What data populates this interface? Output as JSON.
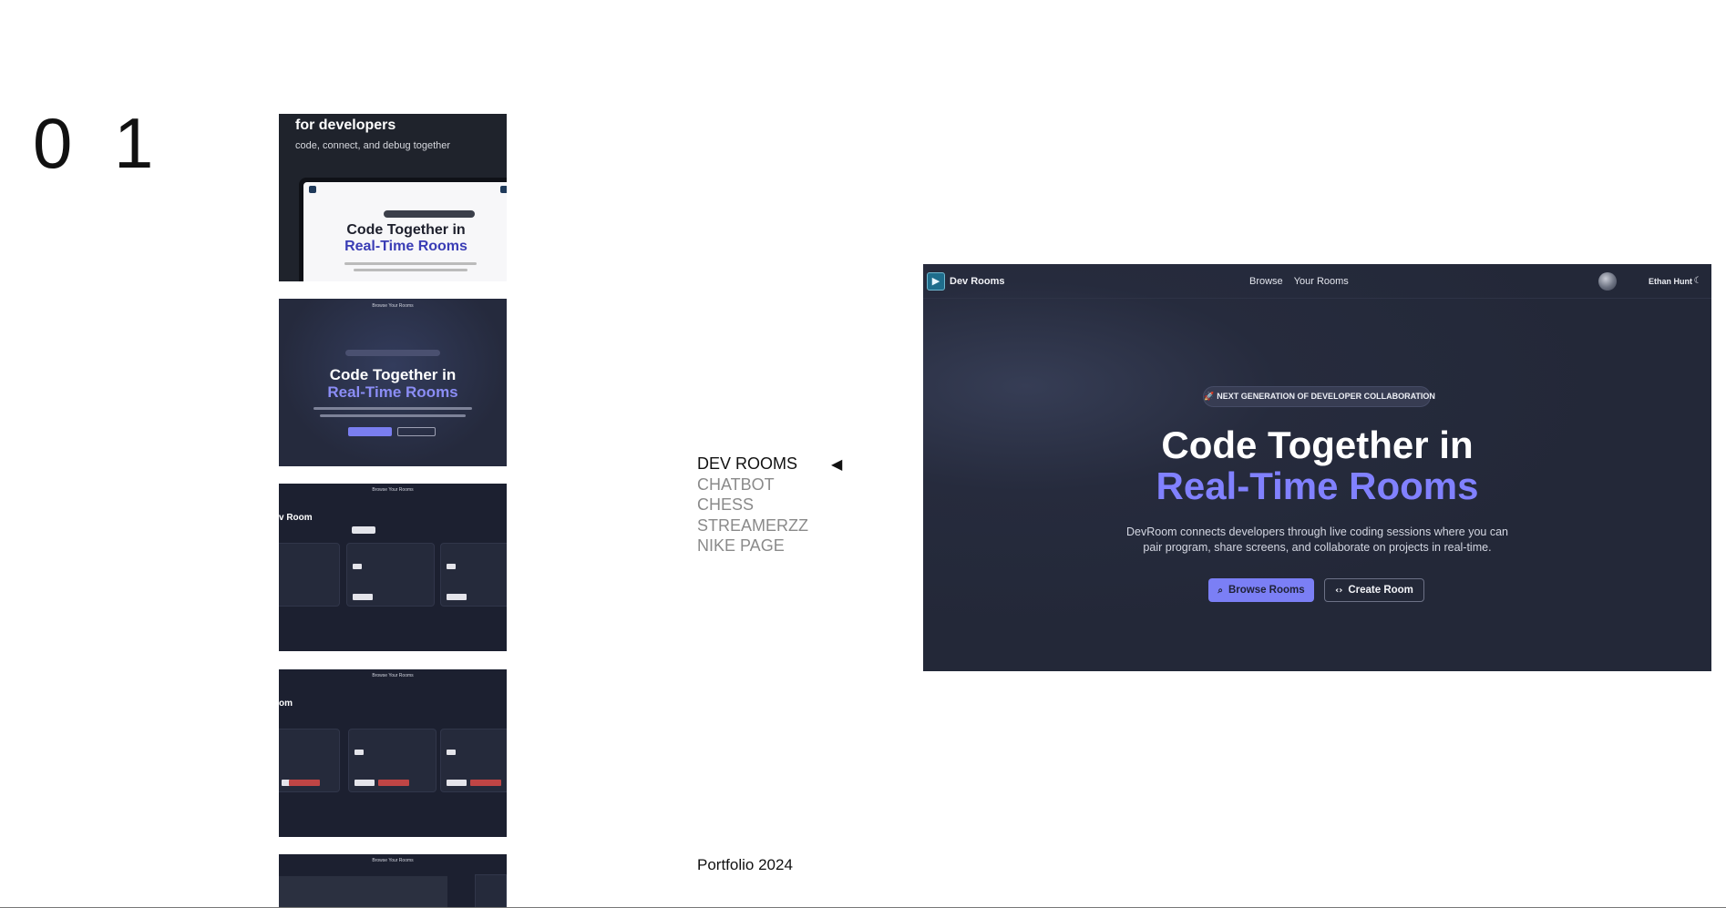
{
  "project": {
    "number": "0 1"
  },
  "thumbnails": {
    "t1": {
      "title": "for developers",
      "subtitle": "code, connect, and debug together",
      "heading1": "Code Together in",
      "heading2": "Real-Time Rooms"
    },
    "t2": {
      "nav": "Browse   Your Rooms",
      "heading1": "Code Together in",
      "heading2": "Real-Time Rooms"
    },
    "t3": {
      "nav": "Browse   Your Rooms",
      "title": "v Room"
    },
    "t4": {
      "nav": "Browse   Your Rooms",
      "title": "om"
    },
    "t5": {
      "nav": "Browse   Your Rooms"
    }
  },
  "menu": {
    "items": [
      {
        "label": "DEV ROOMS",
        "active": true
      },
      {
        "label": "CHATBOT",
        "active": false
      },
      {
        "label": "CHESS",
        "active": false
      },
      {
        "label": "STREAMERZZ",
        "active": false
      },
      {
        "label": "NIKE PAGE",
        "active": false
      }
    ],
    "active_indicator": "◀"
  },
  "footer": {
    "year_label": "Portfolio 2024"
  },
  "preview": {
    "brand": "Dev Rooms",
    "nav_links": [
      "Browse",
      "Your Rooms"
    ],
    "user_name": "Ethan Hunt",
    "badge": "NEXT GENERATION OF DEVELOPER COLLABORATION",
    "heading_line1": "Code Together in",
    "heading_line2": "Real-Time Rooms",
    "description": "DevRoom connects developers through live coding sessions where you can pair program, share screens, and collaborate on projects in real-time.",
    "primary_button": "Browse Rooms",
    "secondary_button": "Create Room",
    "icons": {
      "logo": "dev-rooms-logo-icon",
      "theme": "moon-icon",
      "search": "search-icon",
      "code": "code-icon",
      "rocket": "rocket-icon"
    },
    "colors": {
      "background": "#232838",
      "accent": "#8181ff",
      "button_primary": "#7b7ff5"
    }
  }
}
